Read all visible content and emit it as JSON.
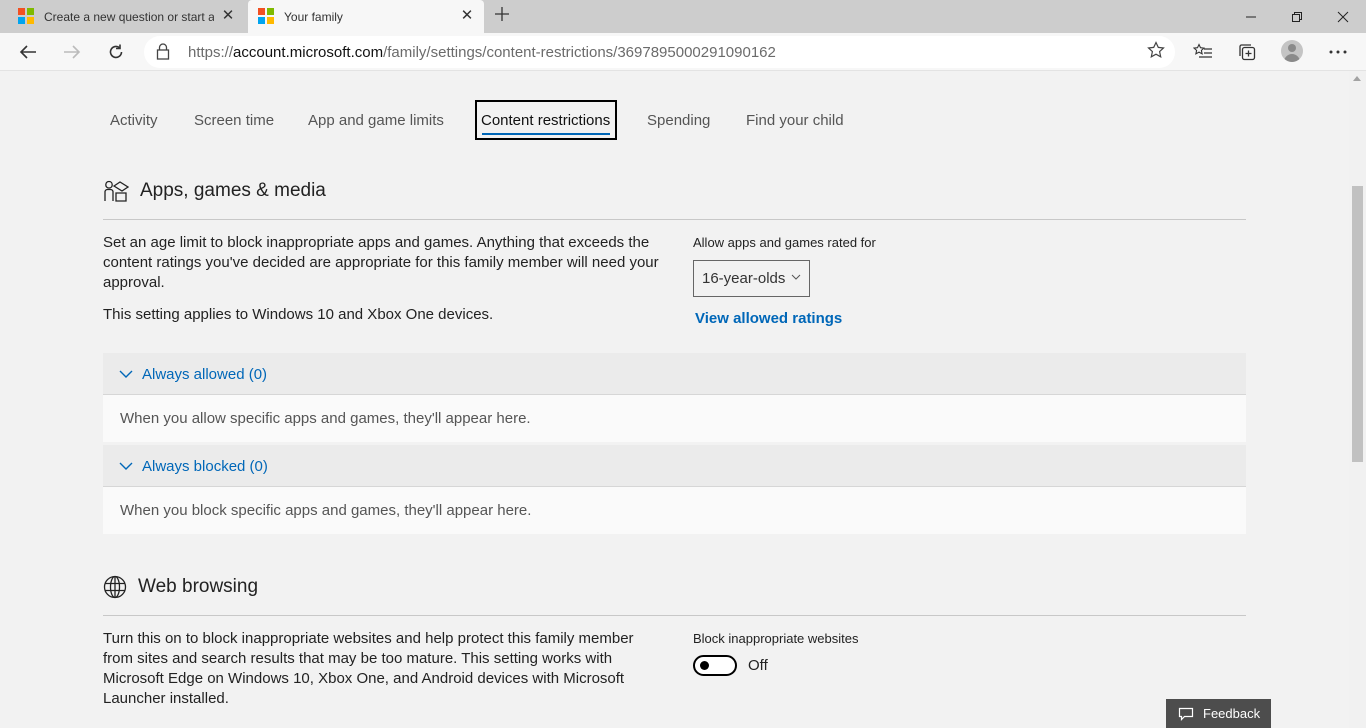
{
  "browser": {
    "tabs": [
      {
        "title": "Create a new question or start a",
        "icon": "microsoft-logo",
        "active": false
      },
      {
        "title": "Your family",
        "icon": "microsoft-logo",
        "active": true
      }
    ],
    "new_tab_icon": "plus-icon",
    "url_host": "account.microsoft.com",
    "url_prefix": "https://",
    "url_path": "/family/settings/content-restrictions/3697895000291090162"
  },
  "pivot_tabs": [
    {
      "label": "Activity"
    },
    {
      "label": "Screen time"
    },
    {
      "label": "App and game limits"
    },
    {
      "label": "Content restrictions",
      "active": true
    },
    {
      "label": "Spending"
    },
    {
      "label": "Find your child"
    }
  ],
  "apps_section": {
    "title": "Apps, games & media",
    "icon": "apps-games-media-icon",
    "description": "Set an age limit to block inappropriate apps and games. Anything that exceeds the content ratings you've decided are appropriate for this family member will need your approval.",
    "applies": "This setting applies to Windows 10 and Xbox One devices.",
    "rating_label": "Allow apps and games rated for",
    "rating_value": "16-year-olds",
    "view_ratings_link": "View allowed ratings",
    "always_allowed": {
      "header": "Always allowed (0)",
      "empty_text": "When you allow specific apps and games, they'll appear here."
    },
    "always_blocked": {
      "header": "Always blocked (0)",
      "empty_text": "When you block specific apps and games, they'll appear here."
    }
  },
  "web_section": {
    "title": "Web browsing",
    "icon": "globe-icon",
    "description": "Turn this on to block inappropriate websites and help protect this family member from sites and search results that may be too mature. This setting works with Microsoft Edge on Windows 10, Xbox One, and Android devices with Microsoft Launcher installed.",
    "toggle_label": "Block inappropriate websites",
    "toggle_state": "Off",
    "toggle_on": false
  },
  "feedback_button": {
    "label": "Feedback",
    "icon": "chat-bubble-icon"
  },
  "colors": {
    "accent": "#0067b8",
    "page_bg": "#f2f2f2",
    "tabstrip_bg": "#cdcdcd"
  }
}
